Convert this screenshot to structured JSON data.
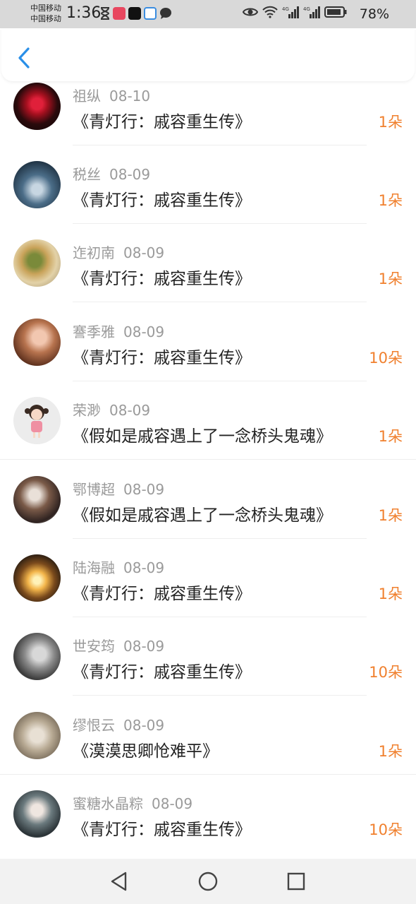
{
  "status_bar": {
    "carrier1": "中国移动",
    "carrier2": "中国移动",
    "time": "1:36",
    "battery": "78%"
  },
  "header": {
    "back_icon": "chevron-left-icon",
    "accent": "#2a8fe8"
  },
  "items": [
    {
      "name": "祖纵",
      "date": "08-10",
      "title": "《青灯行：戚容重生传》",
      "amount": "1朵"
    },
    {
      "name": "税丝",
      "date": "08-09",
      "title": "《青灯行：戚容重生传》",
      "amount": "1朵"
    },
    {
      "name": "迮初南",
      "date": "08-09",
      "title": "《青灯行：戚容重生传》",
      "amount": "1朵"
    },
    {
      "name": "謇季雅",
      "date": "08-09",
      "title": "《青灯行：戚容重生传》",
      "amount": "10朵"
    },
    {
      "name": "荣渺",
      "date": "08-09",
      "title": "《假如是戚容遇上了一念桥头鬼魂》",
      "amount": "1朵"
    },
    {
      "name": "鄂博超",
      "date": "08-09",
      "title": "《假如是戚容遇上了一念桥头鬼魂》",
      "amount": "1朵"
    },
    {
      "name": "陆海融",
      "date": "08-09",
      "title": "《青灯行：戚容重生传》",
      "amount": "1朵"
    },
    {
      "name": "世安筠",
      "date": "08-09",
      "title": "《青灯行：戚容重生传》",
      "amount": "10朵"
    },
    {
      "name": "缪恨云",
      "date": "08-09",
      "title": "《漠漠思卿怆难平》",
      "amount": "1朵"
    },
    {
      "name": "蜜糖水晶粽",
      "date": "08-09",
      "title": "《青灯行：戚容重生传》",
      "amount": "10朵"
    }
  ],
  "colors": {
    "amount": "#f0802e",
    "name": "#9a9a9a",
    "title": "#222222"
  },
  "nav": {
    "back": "triangle-back-icon",
    "home": "circle-home-icon",
    "recents": "square-recents-icon"
  }
}
